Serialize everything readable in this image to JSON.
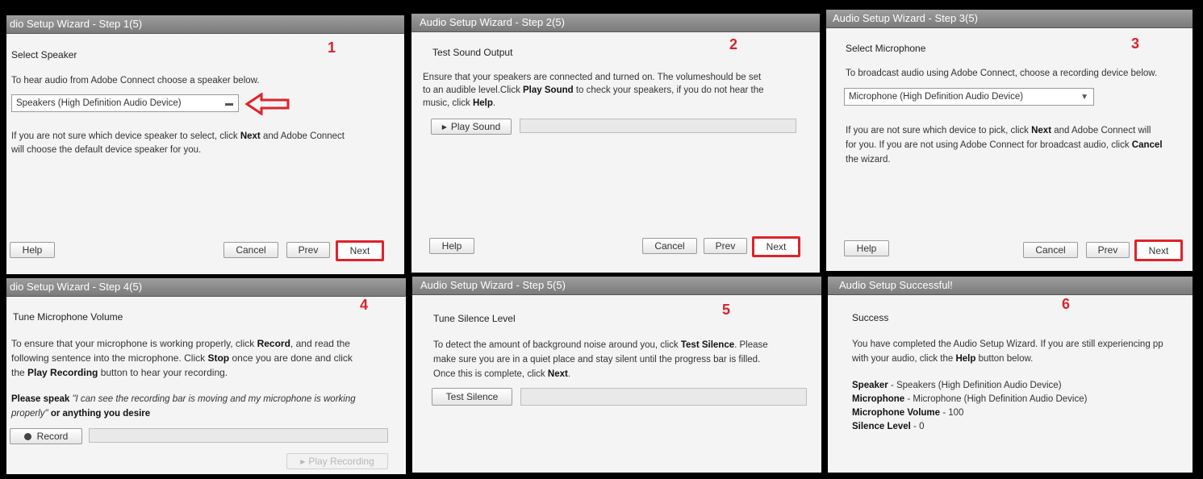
{
  "colors": {
    "accent_red": "#d9232d",
    "panel_bg": "#f4f4f4",
    "title_bg": "#8a8a8a"
  },
  "common": {
    "help": "Help",
    "cancel": "Cancel",
    "prev": "Prev",
    "next": "Next"
  },
  "p1": {
    "title": "dio Setup Wizard - Step 1(5)",
    "number": "1",
    "heading": "Select Speaker",
    "line1": "To hear audio from Adobe Connect choose a speaker below.",
    "select_value": "Speakers (High Definition Audio Device)",
    "note_a": "If you are not sure which device speaker to select, click ",
    "note_b": "Next",
    "note_c": " and Adobe Connect",
    "note_d": "will choose the default device speaker for you."
  },
  "p2": {
    "title": "Audio Setup Wizard - Step 2(5)",
    "number": "2",
    "heading": "Test Sound Output",
    "line1": "Ensure that your speakers are connected and turned on. The volumeshould be set",
    "line2a": "to an audible level.Click ",
    "line2b": "Play Sound",
    "line2c": " to check your speakers, if you do not hear the",
    "line3a": "music, click ",
    "line3b": "Help",
    "line3c": ".",
    "play_label": "Play Sound"
  },
  "p3": {
    "title": "Audio Setup Wizard - Step 3(5)",
    "number": "3",
    "heading": "Select Microphone",
    "line1": "To broadcast audio using Adobe Connect, choose a recording device below.",
    "select_value": "Microphone (High Definition Audio Device)",
    "note1a": "If you are not sure which device to pick, click ",
    "note1b": "Next",
    "note1c": " and Adobe Connect will",
    "note2a": "for you. If you are not using Adobe Connect for broadcast audio, click ",
    "note2b": "Cancel",
    "note3": "the wizard."
  },
  "p4": {
    "title": "dio Setup Wizard - Step 4(5)",
    "number": "4",
    "heading": "Tune Microphone Volume",
    "l1a": "To ensure that your microphone is working properly, click ",
    "l1b": "Record",
    "l1c": ", and read the",
    "l2a": "following sentence into the microphone. Click ",
    "l2b": "Stop",
    "l2c": " once you are done and click",
    "l3a": "the ",
    "l3b": "Play Recording",
    "l3c": " button to hear your recording.",
    "speak_a": "Please speak ",
    "speak_b": "\"I can see the recording bar is moving and my microphone is working",
    "speak_c": "properly\"",
    "speak_d": " or anything you desire",
    "record_label": "Record",
    "play_recording_label": "Play Recording"
  },
  "p5": {
    "title": "Audio Setup Wizard - Step 5(5)",
    "number": "5",
    "heading": "Tune Silence Level",
    "l1a": "To detect the amount of background noise around you, click ",
    "l1b": "Test Silence",
    "l1c": ". Please",
    "l2": "make sure you are in a quiet place and stay silent until the progress bar is filled.",
    "l3a": "Once this is complete, click ",
    "l3b": "Next",
    "l3c": ".",
    "test_label": "Test Silence"
  },
  "p6": {
    "title": "Audio Setup Successful!",
    "number": "6",
    "heading": "Success",
    "l1": "You have completed the Audio Setup Wizard. If you are still experiencing pp",
    "l2a": "with your audio, click the ",
    "l2b": "Help",
    "l2c": " button below.",
    "s1a": "Speaker",
    "s1b": " - Speakers (High Definition Audio Device)",
    "s2a": "Microphone",
    "s2b": " - Microphone (High Definition Audio Device)",
    "s3a": "Microphone Volume",
    "s3b": " - 100",
    "s4a": "Silence Level",
    "s4b": " - 0"
  }
}
